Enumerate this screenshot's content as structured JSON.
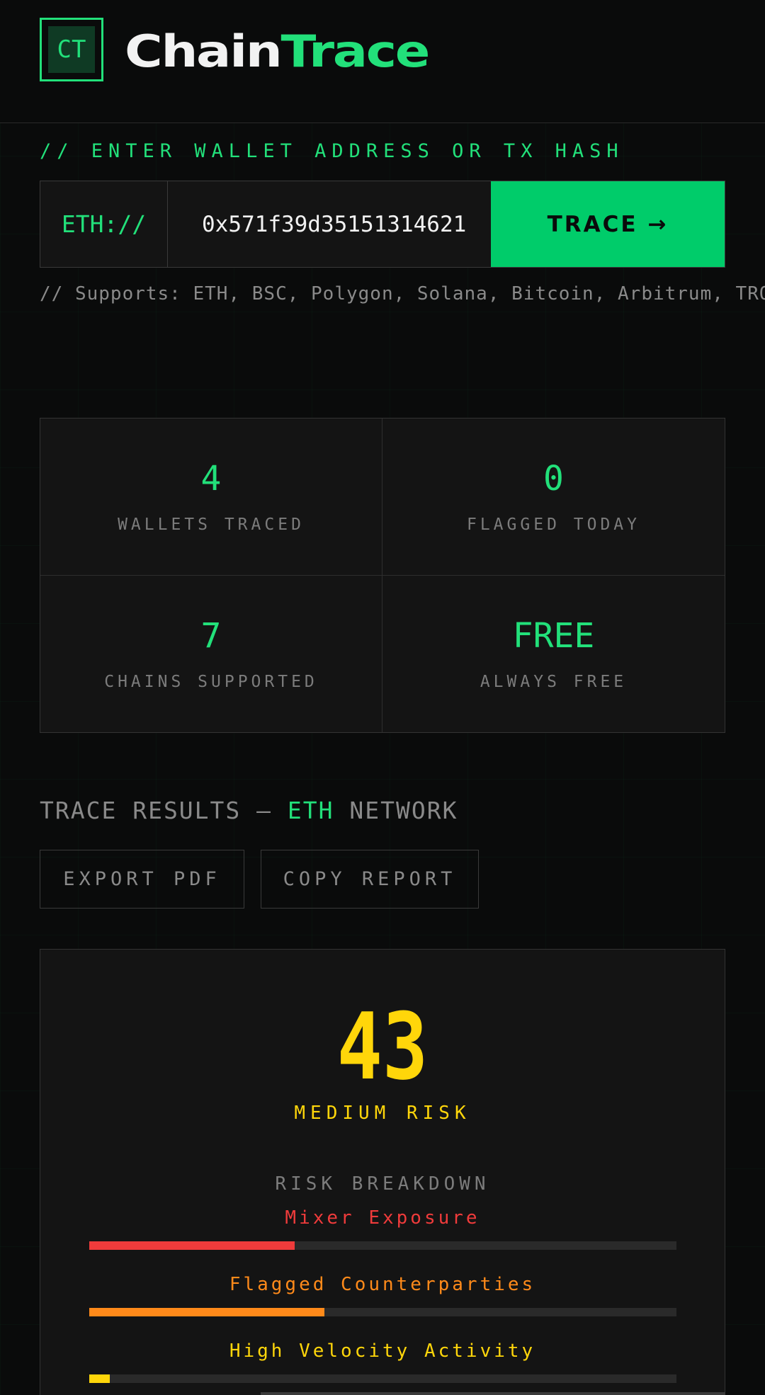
{
  "brand": {
    "logo_text": "CT",
    "name_part1": "Chain",
    "name_part2": "Trace",
    "accent": "#22e07a"
  },
  "search": {
    "label": "// ENTER WALLET ADDRESS OR TX HASH",
    "prefix": "ETH://",
    "value": "0x571f39d35151314621",
    "button_label": "TRACE →",
    "supports": "// Supports: ETH, BSC, Polygon, Solana, Bitcoin, Arbitrum, TRON"
  },
  "stats": [
    {
      "value": "4",
      "label": "WALLETS TRACED"
    },
    {
      "value": "0",
      "label": "FLAGGED TODAY"
    },
    {
      "value": "7",
      "label": "CHAINS SUPPORTED"
    },
    {
      "value": "FREE",
      "label": "ALWAYS FREE"
    }
  ],
  "results": {
    "title_prefix": "TRACE RESULTS — ",
    "network": "ETH",
    "title_suffix": " NETWORK",
    "export_label": "EXPORT PDF",
    "copy_label": "COPY REPORT"
  },
  "risk": {
    "score": "43",
    "level": "MEDIUM RISK",
    "breakdown_title": "RISK BREAKDOWN",
    "factors": [
      {
        "label": "Mixer Exposure",
        "fraction": 0.35,
        "color": "#ef3b3b"
      },
      {
        "label": "Flagged Counterparties",
        "fraction": 0.4,
        "color": "#ff8a1a"
      },
      {
        "label": "High Velocity Activity",
        "fraction": 0.035,
        "color": "#ffd60a"
      }
    ]
  }
}
